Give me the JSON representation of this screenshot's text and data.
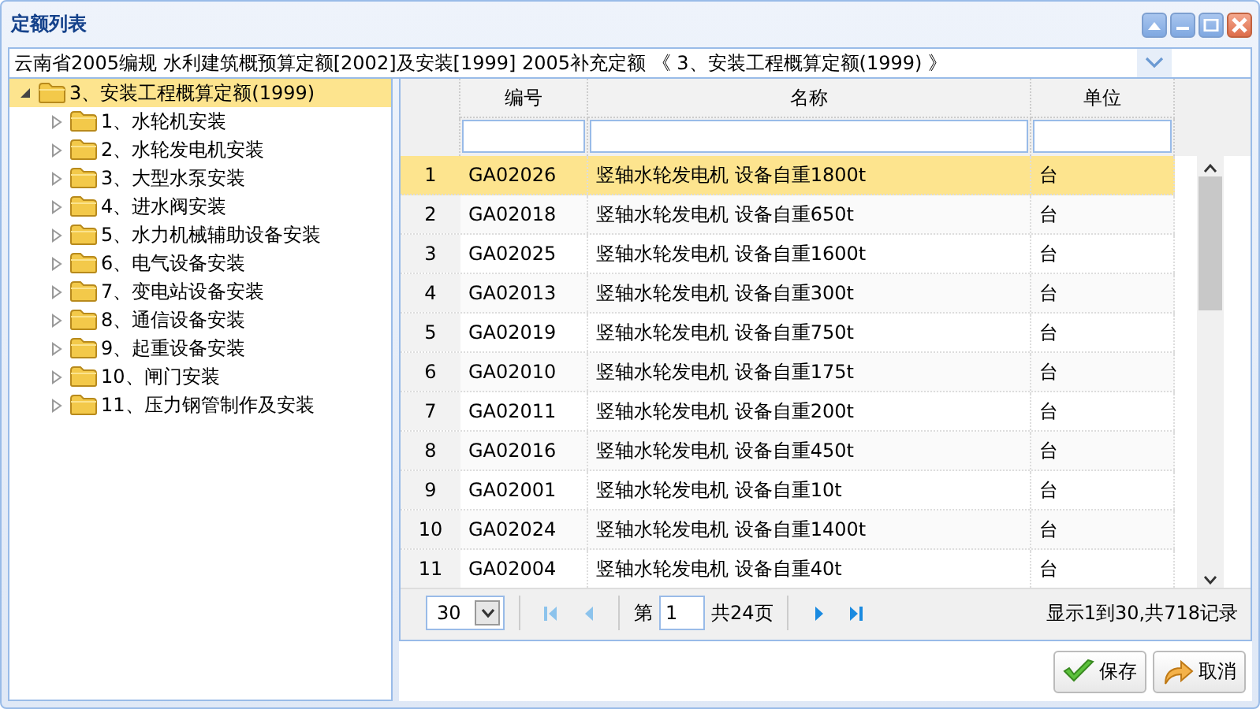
{
  "window": {
    "title": "定额列表"
  },
  "selector": {
    "value": "云南省2005编规 水利建筑概预算定额[2002]及安装[1999] 2005补充定额 《 3、安装工程概算定额(1999) 》"
  },
  "tree": [
    {
      "label": "3、安装工程概算定额(1999)",
      "expanded": true,
      "selected": true,
      "children": [
        {
          "label": "1、水轮机安装",
          "expanded": false,
          "selected": false
        },
        {
          "label": "2、水轮发电机安装",
          "expanded": false,
          "selected": false
        },
        {
          "label": "3、大型水泵安装",
          "expanded": false,
          "selected": false
        },
        {
          "label": "4、进水阀安装",
          "expanded": false,
          "selected": false
        },
        {
          "label": "5、水力机械辅助设备安装",
          "expanded": false,
          "selected": false
        },
        {
          "label": "6、电气设备安装",
          "expanded": false,
          "selected": false
        },
        {
          "label": "7、变电站设备安装",
          "expanded": false,
          "selected": false
        },
        {
          "label": "8、通信设备安装",
          "expanded": false,
          "selected": false
        },
        {
          "label": "9、起重设备安装",
          "expanded": false,
          "selected": false
        },
        {
          "label": "10、闸门安装",
          "expanded": false,
          "selected": false
        },
        {
          "label": "11、压力钢管制作及安装",
          "expanded": false,
          "selected": false
        }
      ]
    }
  ],
  "table": {
    "columns": [
      "编号",
      "名称",
      "单位"
    ],
    "rows": [
      {
        "index": "1",
        "code": "GA02026",
        "name": "竖轴水轮发电机 设备自重1800t",
        "unit": "台",
        "selected": true
      },
      {
        "index": "2",
        "code": "GA02018",
        "name": "竖轴水轮发电机 设备自重650t",
        "unit": "台",
        "selected": false
      },
      {
        "index": "3",
        "code": "GA02025",
        "name": "竖轴水轮发电机 设备自重1600t",
        "unit": "台",
        "selected": false
      },
      {
        "index": "4",
        "code": "GA02013",
        "name": "竖轴水轮发电机 设备自重300t",
        "unit": "台",
        "selected": false
      },
      {
        "index": "5",
        "code": "GA02019",
        "name": "竖轴水轮发电机 设备自重750t",
        "unit": "台",
        "selected": false
      },
      {
        "index": "6",
        "code": "GA02010",
        "name": "竖轴水轮发电机 设备自重175t",
        "unit": "台",
        "selected": false
      },
      {
        "index": "7",
        "code": "GA02011",
        "name": "竖轴水轮发电机 设备自重200t",
        "unit": "台",
        "selected": false
      },
      {
        "index": "8",
        "code": "GA02016",
        "name": "竖轴水轮发电机 设备自重450t",
        "unit": "台",
        "selected": false
      },
      {
        "index": "9",
        "code": "GA02001",
        "name": "竖轴水轮发电机 设备自重10t",
        "unit": "台",
        "selected": false
      },
      {
        "index": "10",
        "code": "GA02024",
        "name": "竖轴水轮发电机 设备自重1400t",
        "unit": "台",
        "selected": false
      },
      {
        "index": "11",
        "code": "GA02004",
        "name": "竖轴水轮发电机 设备自重40t",
        "unit": "台",
        "selected": false
      }
    ]
  },
  "pager": {
    "page_size": "30",
    "page_label": "第",
    "page": "1",
    "total_pages": "共24页",
    "summary": "显示1到30,共718记录"
  },
  "buttons": [
    {
      "label": "保存",
      "kind": "save"
    },
    {
      "label": "取消",
      "kind": "cancel"
    }
  ]
}
